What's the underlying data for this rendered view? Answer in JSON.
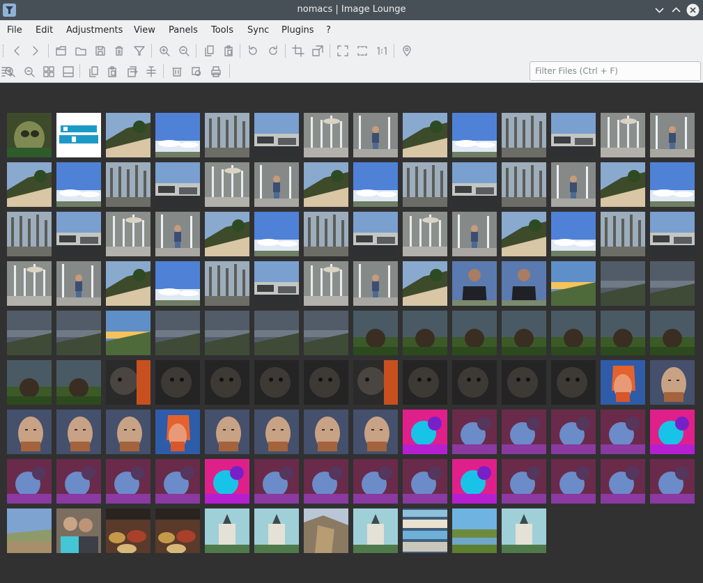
{
  "window": {
    "title": "nomacs | Image Lounge"
  },
  "menu": [
    "File",
    "Edit",
    "Adjustments",
    "View",
    "Panels",
    "Tools",
    "Sync",
    "Plugins",
    "?"
  ],
  "toolbar1": [
    "arrow-left-icon",
    "arrow-right-icon",
    "folder-open-icon",
    "folder-icon",
    "save-icon",
    "trash-icon",
    "filter-icon",
    "zoom-in-icon",
    "zoom-out-icon",
    "copy-icon",
    "paste-icon",
    "rotate-left-icon",
    "rotate-right-icon",
    "crop-icon",
    "resize-icon",
    "fullscreen-icon",
    "frameless-icon",
    "actual-size-icon",
    "map-pin-icon"
  ],
  "toolbar2": [
    "zoom-in-icon",
    "zoom-out-icon",
    "grid-icon",
    "show-filenames-icon",
    "copy-icon",
    "paste-icon",
    "rename-icon",
    "batch-icon",
    "delete-icon",
    "batch-process-icon",
    "print-icon",
    "sort-icon"
  ],
  "filter": {
    "value": "",
    "placeholder": "Filter Files (Ctrl + F)"
  },
  "thumbnails": [
    "bunny",
    "logo",
    "hill",
    "sky",
    "trees",
    "cars",
    "fountain",
    "boy",
    "hill",
    "sky",
    "trees",
    "cars",
    "fountain",
    "boy",
    "hill",
    "sky",
    "trees",
    "cars",
    "fountain",
    "boy",
    "hill",
    "sky",
    "trees",
    "cars",
    "trees",
    "boy",
    "hill",
    "sky",
    "trees",
    "cars",
    "fountain",
    "boy",
    "hill",
    "sky",
    "trees",
    "cars",
    "fountain",
    "boy",
    "hill",
    "sky",
    "trees",
    "cars",
    "fountain",
    "boy",
    "hill",
    "sky",
    "trees",
    "cars",
    "fountain",
    "boy",
    "hill",
    "man",
    "man",
    "sunset",
    "dusk",
    "dusk",
    "dusk",
    "dusk",
    "sunset",
    "dusk",
    "dusk",
    "dusk",
    "dusk",
    "meadow",
    "meadow",
    "meadow",
    "meadow",
    "meadow",
    "meadow",
    "meadow",
    "meadow",
    "meadow",
    "creature",
    "creaturedark",
    "creaturedark",
    "creaturedark",
    "creaturedark",
    "creature",
    "creaturedark",
    "creaturedark",
    "creaturedark",
    "creaturedark",
    "redhair",
    "facepale",
    "facepale",
    "facepale",
    "facepale",
    "redhair",
    "facepale",
    "facepale",
    "facepale",
    "facepale",
    "neon",
    "purple",
    "purple",
    "purple",
    "purple",
    "neon",
    "purple",
    "purple",
    "purple",
    "purple",
    "neon",
    "purple",
    "purple",
    "purple",
    "purple",
    "neon",
    "purple",
    "purple",
    "purple",
    "purple",
    "landscape",
    "girls",
    "food",
    "food",
    "church",
    "church",
    "cliff",
    "church",
    "collage",
    "pond",
    "church"
  ],
  "colors": {
    "titlebar": "#475057",
    "toolbar": "#eff0f1",
    "thumbnail_bg": "#313131"
  }
}
